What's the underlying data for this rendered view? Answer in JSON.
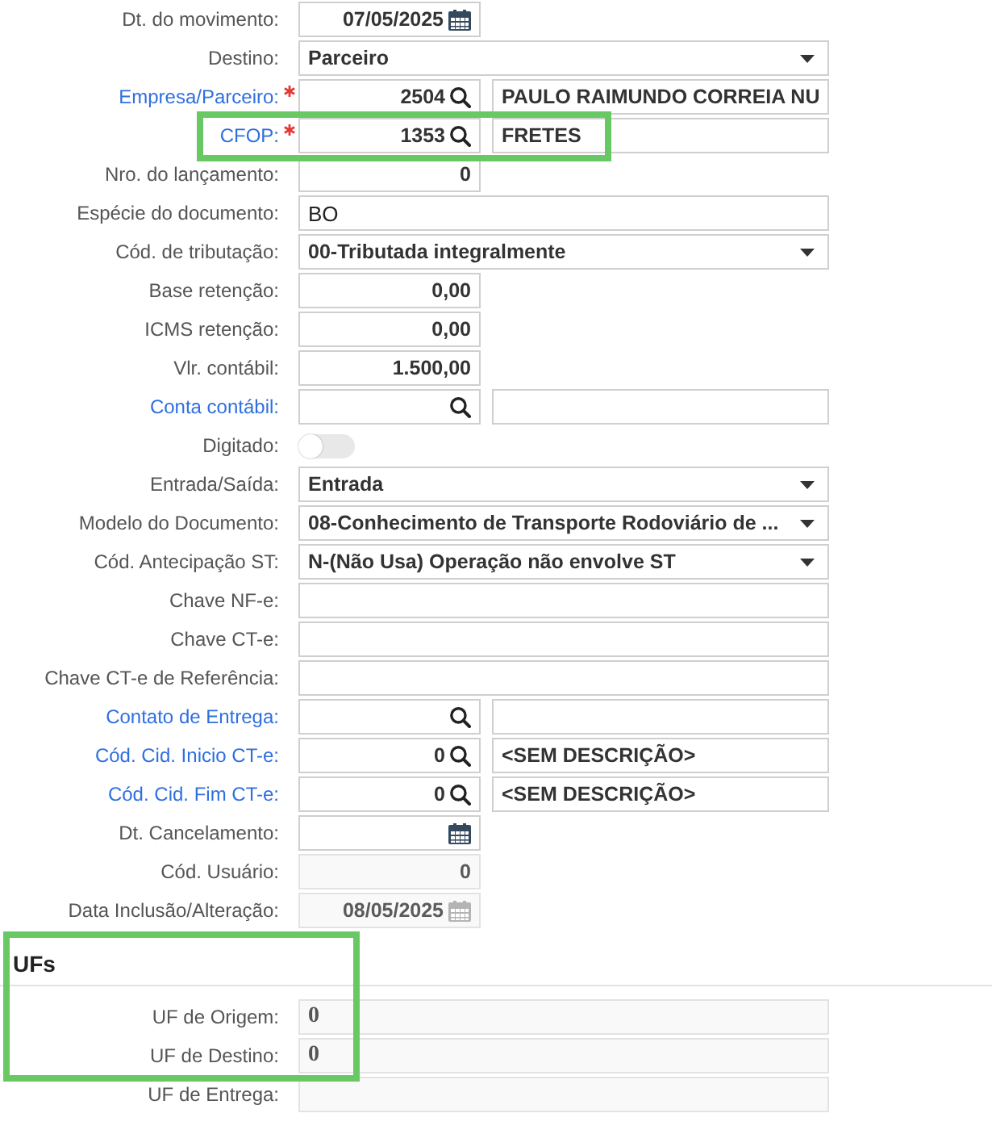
{
  "form": {
    "fields": [
      {
        "kind": "date",
        "label": "Dt. do movimento:",
        "value": "07/05/2025",
        "required": false,
        "disabled": false,
        "highlighted": false
      },
      {
        "kind": "select",
        "label": "Destino:",
        "value": "Parceiro",
        "required": false,
        "disabled": false,
        "highlighted": false
      },
      {
        "kind": "lookup",
        "label": "Empresa/Parceiro:",
        "code": "2504",
        "description": "PAULO RAIMUNDO CORREIA NU",
        "required": true,
        "disabled": false,
        "highlighted": false
      },
      {
        "kind": "lookup",
        "label": "CFOP:",
        "code": "1353",
        "description": "FRETES",
        "required": true,
        "disabled": false,
        "highlighted": true
      },
      {
        "kind": "number",
        "label": "Nro. do lançamento:",
        "value": "0",
        "required": false,
        "disabled": false,
        "highlighted": false
      },
      {
        "kind": "text",
        "label": "Espécie do documento:",
        "value": "BO",
        "required": false,
        "disabled": false,
        "highlighted": false
      },
      {
        "kind": "select",
        "label": "Cód. de tributação:",
        "value": "00-Tributada integralmente",
        "required": false,
        "disabled": false,
        "highlighted": false
      },
      {
        "kind": "number",
        "label": "Base retenção:",
        "value": "0,00",
        "required": false,
        "disabled": false,
        "highlighted": false
      },
      {
        "kind": "number",
        "label": "ICMS retenção:",
        "value": "0,00",
        "required": false,
        "disabled": false,
        "highlighted": false
      },
      {
        "kind": "number",
        "label": "Vlr. contábil:",
        "value": "1.500,00",
        "required": false,
        "disabled": false,
        "highlighted": false
      },
      {
        "kind": "lookup",
        "label": "Conta contábil:",
        "required": false,
        "disabled": false,
        "highlighted": false
      },
      {
        "kind": "toggle",
        "label": "Digitado:",
        "on": false,
        "required": false,
        "disabled": false,
        "highlighted": false
      },
      {
        "kind": "select",
        "label": "Entrada/Saída:",
        "value": "Entrada",
        "required": false,
        "disabled": false,
        "highlighted": false
      },
      {
        "kind": "select",
        "label": "Modelo do Documento:",
        "value": "08-Conhecimento de Transporte Rodoviário de ...",
        "required": false,
        "disabled": false,
        "highlighted": false
      },
      {
        "kind": "select",
        "label": "Cód. Antecipação ST:",
        "value": "N-(Não Usa) Operação não envolve ST",
        "required": false,
        "disabled": false,
        "highlighted": false
      },
      {
        "kind": "text",
        "label": "Chave NF-e:",
        "required": false,
        "disabled": false,
        "highlighted": false
      },
      {
        "kind": "text",
        "label": "Chave CT-e:",
        "required": false,
        "disabled": false,
        "highlighted": false
      },
      {
        "kind": "text",
        "label": "Chave CT-e de Referência:",
        "required": false,
        "disabled": false,
        "highlighted": false
      },
      {
        "kind": "lookup",
        "label": "Contato de Entrega:",
        "required": false,
        "disabled": false,
        "highlighted": false
      },
      {
        "kind": "lookup",
        "label": "Cód. Cid. Inicio CT-e:",
        "code": "0",
        "description": "<SEM DESCRIÇÃO>",
        "required": false,
        "disabled": false,
        "highlighted": false
      },
      {
        "kind": "lookup",
        "label": "Cód. Cid. Fim CT-e:",
        "code": "0",
        "description": "<SEM DESCRIÇÃO>",
        "required": false,
        "disabled": false,
        "highlighted": false
      },
      {
        "kind": "date",
        "label": "Dt. Cancelamento:",
        "required": false,
        "disabled": false,
        "highlighted": false
      },
      {
        "kind": "number",
        "label": "Cód. Usuário:",
        "value": "0",
        "required": false,
        "disabled": true,
        "highlighted": false
      },
      {
        "kind": "date",
        "label": "Data Inclusão/Alteração:",
        "value": "08/05/2025",
        "required": false,
        "disabled": true,
        "highlighted": false
      }
    ]
  },
  "sections": [
    {
      "title": "UFs",
      "highlighted": true,
      "fields": [
        {
          "kind": "text",
          "label": "UF de Origem:",
          "value": "0",
          "required": false,
          "disabled": true
        },
        {
          "kind": "text",
          "label": "UF de Destino:",
          "value": "0",
          "required": false,
          "disabled": true
        },
        {
          "kind": "text",
          "label": "UF de Entrega:",
          "required": false,
          "disabled": true
        }
      ]
    }
  ]
}
